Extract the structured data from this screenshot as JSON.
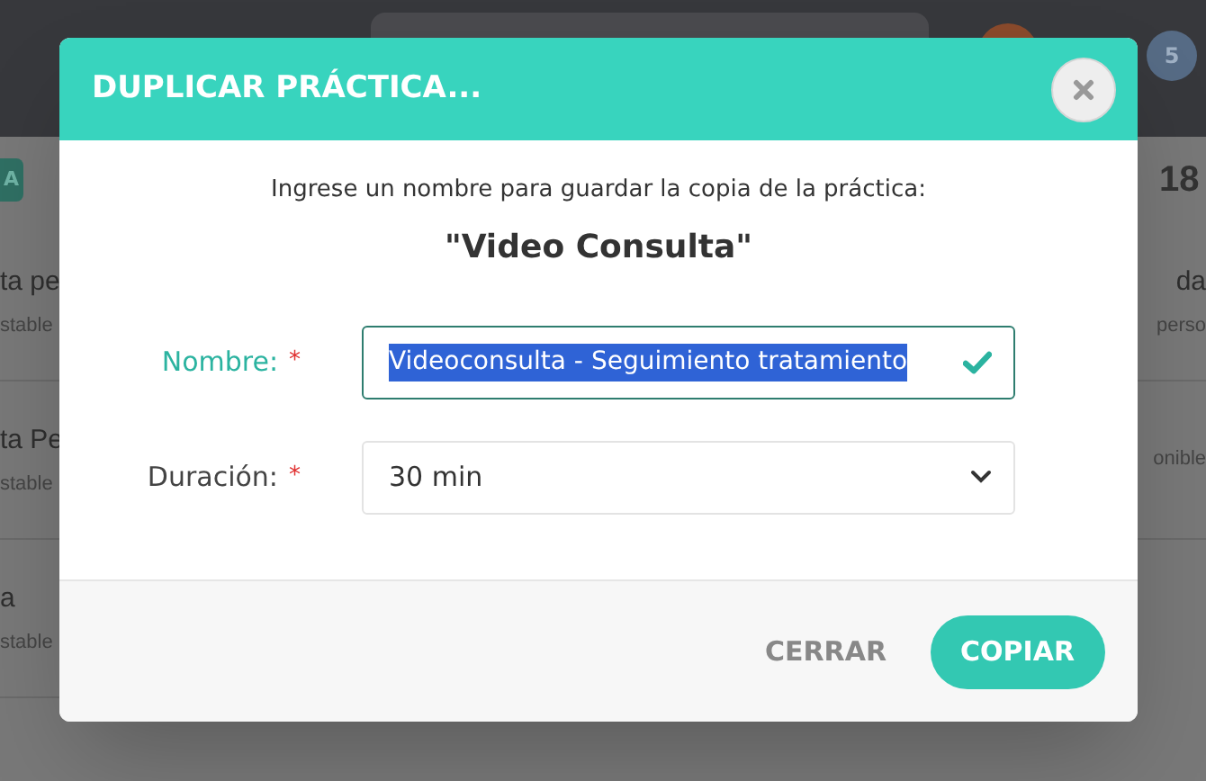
{
  "background": {
    "badge_letter": "A",
    "counter": "18",
    "notification_count": "5",
    "left_rows": [
      {
        "title": "ta pe",
        "subtitle": "stable"
      },
      {
        "title": "ta Pe",
        "subtitle": "stable"
      },
      {
        "title": "a",
        "subtitle": "stable"
      }
    ],
    "right_rows": [
      {
        "title": "da",
        "subtitle": "perso"
      },
      {
        "subtitle": "onible"
      }
    ]
  },
  "dialog": {
    "title": "DUPLICAR PRÁCTICA...",
    "prompt": "Ingrese un nombre para guardar la copia de la práctica:",
    "source_name": "\"Video Consulta\"",
    "required_mark": "*",
    "fields": [
      {
        "kind": "text",
        "label": "Nombre:",
        "required": true,
        "value": "Videoconsulta - Seguimiento tratamiento",
        "valid": true,
        "focused": true
      },
      {
        "kind": "select",
        "label": "Duración:",
        "required": true,
        "value": "30 min",
        "valid": false,
        "focused": false
      }
    ],
    "buttons": [
      {
        "label": "CERRAR",
        "primary": false
      },
      {
        "label": "COPIAR",
        "primary": true
      }
    ]
  }
}
